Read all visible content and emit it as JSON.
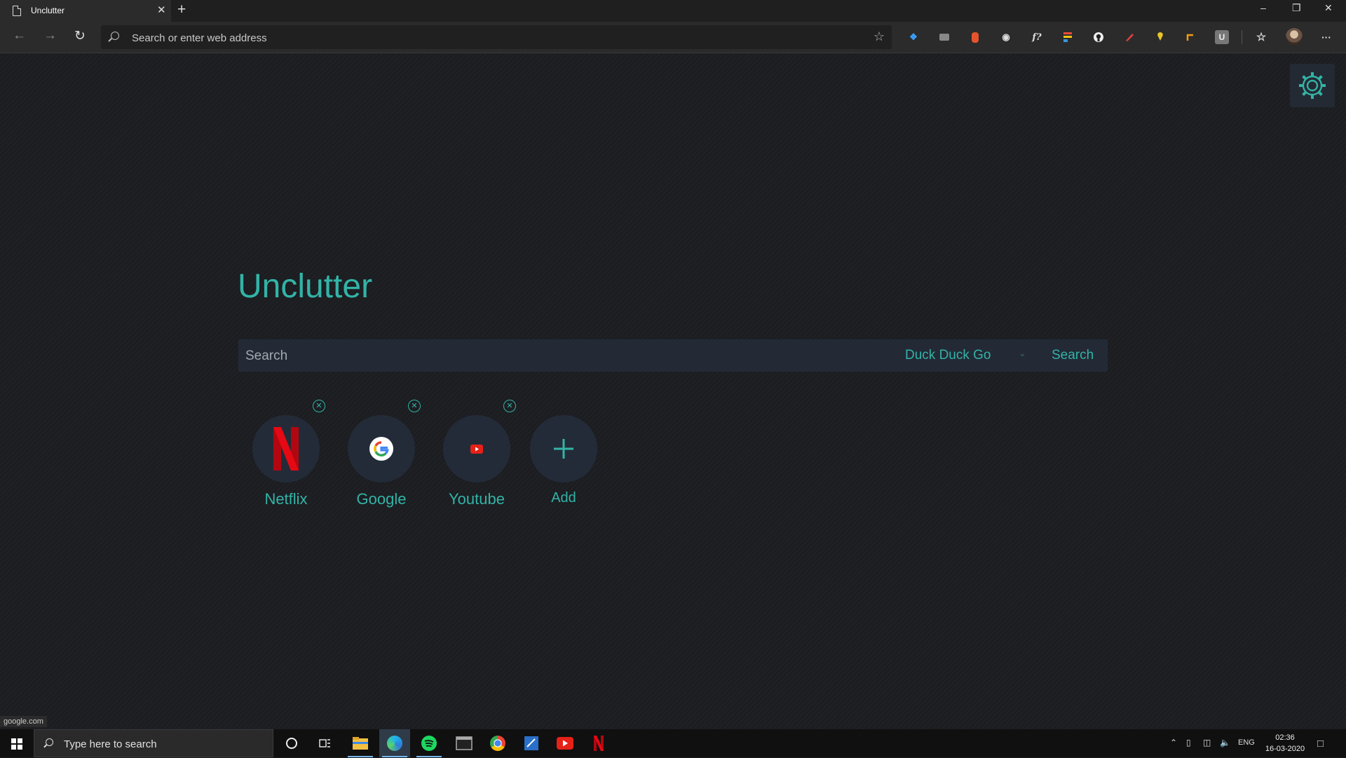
{
  "browser": {
    "tab_title": "Unclutter",
    "tab_close": "✕",
    "new_tab": "+",
    "address_placeholder": "Search or enter web address",
    "window_controls": [
      "–",
      "❐",
      "✕"
    ],
    "more_label": "···",
    "extension_icons": [
      "dashlane-icon",
      "ext-box-icon",
      "ext-fire-icon",
      "camera-icon",
      "function-icon",
      "sheets-icon",
      "github-icon",
      "pen-icon",
      "pin-icon",
      "ext-arrow-icon",
      "u-icon"
    ],
    "extension_u_letter": "U",
    "extension_f_label": "f?"
  },
  "page": {
    "brand_title": "Unclutter",
    "search_placeholder": "Search",
    "search_engine": "Duck Duck Go",
    "search_button": "Search",
    "shortcuts": [
      {
        "label": "Netflix",
        "icon": "netflix-logo-icon"
      },
      {
        "label": "Google",
        "icon": "google-logo-icon"
      },
      {
        "label": "Youtube",
        "icon": "youtube-logo-icon"
      }
    ],
    "add_label": "Add",
    "status_url": "google.com"
  },
  "taskbar": {
    "search_placeholder": "Type here to search",
    "language": "ENG",
    "time": "02:36",
    "date": "16-03-2020"
  },
  "colors": {
    "accent": "#33b3a6",
    "page_bg": "#1b1d21",
    "tile_bg": "#242b38",
    "search_bg": "#232a36"
  }
}
